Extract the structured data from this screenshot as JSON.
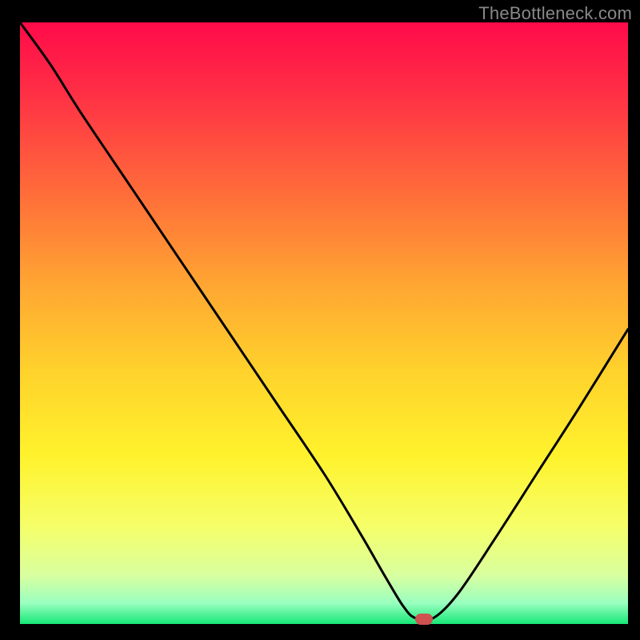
{
  "watermark": "TheBottleneck.com",
  "chart_data": {
    "type": "line",
    "title": "",
    "xlabel": "",
    "ylabel": "",
    "xlim": [
      0,
      100
    ],
    "ylim": [
      0,
      100
    ],
    "x": [
      0,
      5,
      10,
      18,
      26,
      34,
      42,
      50,
      56,
      60,
      63,
      65,
      68,
      72,
      78,
      85,
      92,
      100
    ],
    "values": [
      100,
      93,
      85,
      73,
      61,
      49,
      37,
      25,
      15,
      8,
      3,
      1,
      1,
      5,
      14,
      25,
      36,
      49
    ],
    "marker": {
      "x": 66.5,
      "y": 0.8
    },
    "gradient_stops": [
      {
        "offset": 0.0,
        "color": "#ff0a4a"
      },
      {
        "offset": 0.12,
        "color": "#ff3045"
      },
      {
        "offset": 0.28,
        "color": "#ff6b3a"
      },
      {
        "offset": 0.44,
        "color": "#ffa732"
      },
      {
        "offset": 0.58,
        "color": "#ffd22c"
      },
      {
        "offset": 0.72,
        "color": "#fff22c"
      },
      {
        "offset": 0.84,
        "color": "#f5ff6a"
      },
      {
        "offset": 0.92,
        "color": "#d8ffa0"
      },
      {
        "offset": 0.965,
        "color": "#9affc0"
      },
      {
        "offset": 1.0,
        "color": "#17e877"
      }
    ]
  }
}
